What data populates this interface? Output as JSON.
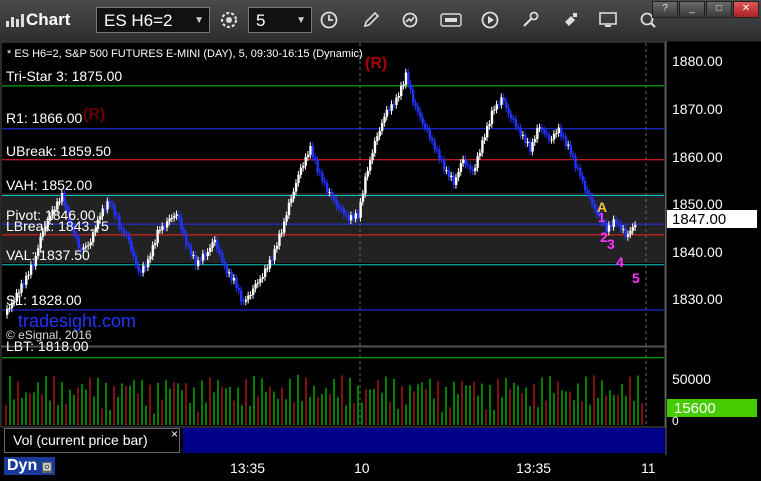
{
  "toolbar": {
    "app_title": "Chart",
    "symbol": "ES H6=2",
    "interval": "5",
    "icons": [
      "chart-app-icon",
      "settings-gear-icon",
      "clock-icon",
      "pencil-draw-icon",
      "refresh-icon",
      "get-data-icon",
      "play-icon",
      "tools-icon",
      "monitor-icon",
      "zoom-icon"
    ],
    "window_controls": [
      "?",
      "_",
      "□",
      "✕"
    ]
  },
  "chart": {
    "title": "* ES H6=2, S&P 500 FUTURES E-MINI (DAY), 5, 09:30-16:15 (Dynamic)",
    "watermark": "tradesight.com",
    "copyright": "© eSignal, 2016",
    "price_axis": [
      "1880.00",
      "1870.00",
      "1860.00",
      "1850.00",
      "1840.00",
      "1830.00"
    ],
    "current_price": "1847.00",
    "levels": [
      {
        "label": "Tri-Star 3: 1875.00",
        "price": 1875.0,
        "color": "#00cc00"
      },
      {
        "label": "R1: 1866.00",
        "price": 1866.0,
        "color": "#2233ff"
      },
      {
        "label": "UBreak: 1859.50",
        "price": 1859.5,
        "color": "#ff2222"
      },
      {
        "label": "VAH: 1852.00",
        "price": 1852.0,
        "color": "#00cccc"
      },
      {
        "label": "Pivot: 1846.00",
        "price": 1846.0,
        "color": "#2233ff"
      },
      {
        "label": "LBreak: 1843.75",
        "price": 1843.75,
        "color": "#ff2222"
      },
      {
        "label": "VAL: 1837.50",
        "price": 1837.5,
        "color": "#00cccc"
      },
      {
        "label": "S1: 1828.00",
        "price": 1828.0,
        "color": "#2233ff"
      },
      {
        "label": "LBT: 1818.00",
        "price": 1818.0,
        "color": "#00cc00"
      }
    ],
    "r_markers": [
      "(R)",
      "(R)"
    ],
    "abc_markers": [
      "A",
      "1",
      "2",
      "3",
      "4",
      "5"
    ],
    "time_axis": [
      "13:35",
      "10",
      "13:35",
      "11"
    ]
  },
  "volume": {
    "tab_label": "Vol (current price bar)",
    "tab_close": "×",
    "axis": [
      "50000",
      "0"
    ],
    "current_volume": "15600"
  },
  "status": {
    "layout": "Dyn"
  },
  "colors": {
    "up_candle": "#ffffff",
    "down_candle": "#2233ff",
    "background": "#000000",
    "vol_up": "#00ff00",
    "vol_down": "#ff2222"
  }
}
